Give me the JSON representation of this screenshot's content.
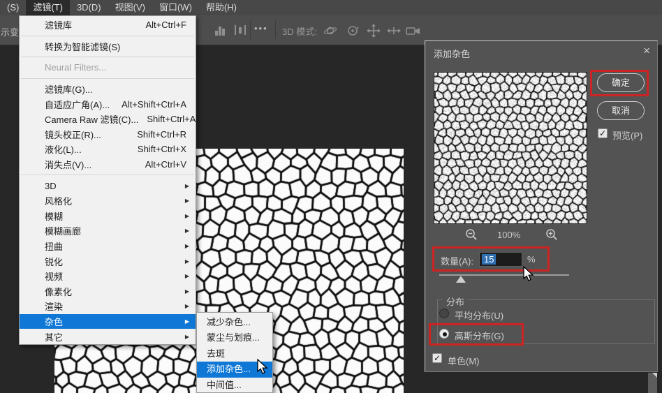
{
  "menubar": {
    "items": [
      {
        "label": "(S)",
        "active": false
      },
      {
        "label": "滤镜(T)",
        "active": true
      },
      {
        "label": "3D(D)",
        "active": false
      },
      {
        "label": "视图(V)",
        "active": false
      },
      {
        "label": "窗口(W)",
        "active": false
      },
      {
        "label": "帮助(H)",
        "active": false
      }
    ]
  },
  "options_bar": {
    "partial_left_text": "示变",
    "ellipsis": "•••",
    "mode_label": "3D 模式:"
  },
  "filter_menu": {
    "items": [
      {
        "label": "滤镜库",
        "shortcut": "Alt+Ctrl+F"
      },
      {
        "sep": true
      },
      {
        "label": "转换为智能滤镜(S)"
      },
      {
        "sep": true
      },
      {
        "label": "Neural Filters...",
        "disabled": true
      },
      {
        "sep": true
      },
      {
        "label": "滤镜库(G)..."
      },
      {
        "label": "自适应广角(A)...",
        "shortcut": "Alt+Shift+Ctrl+A"
      },
      {
        "label": "Camera Raw 滤镜(C)...",
        "shortcut": "Shift+Ctrl+A"
      },
      {
        "label": "镜头校正(R)...",
        "shortcut": "Shift+Ctrl+R"
      },
      {
        "label": "液化(L)...",
        "shortcut": "Shift+Ctrl+X"
      },
      {
        "label": "消失点(V)...",
        "shortcut": "Alt+Ctrl+V"
      },
      {
        "sep": true
      },
      {
        "label": "3D",
        "submenu": true
      },
      {
        "label": "风格化",
        "submenu": true
      },
      {
        "label": "模糊",
        "submenu": true
      },
      {
        "label": "模糊画廊",
        "submenu": true
      },
      {
        "label": "扭曲",
        "submenu": true
      },
      {
        "label": "锐化",
        "submenu": true
      },
      {
        "label": "视频",
        "submenu": true
      },
      {
        "label": "像素化",
        "submenu": true
      },
      {
        "label": "渲染",
        "submenu": true
      },
      {
        "label": "杂色",
        "submenu": true,
        "highlighted": true
      },
      {
        "label": "其它",
        "submenu": true
      }
    ]
  },
  "noise_submenu": {
    "items": [
      {
        "label": "减少杂色..."
      },
      {
        "label": "蒙尘与划痕..."
      },
      {
        "label": "去斑"
      },
      {
        "label": "添加杂色...",
        "highlighted": true
      },
      {
        "label": "中间值..."
      }
    ]
  },
  "dialog": {
    "title": "添加杂色",
    "close_glyph": "×",
    "ok_label": "确定",
    "cancel_label": "取消",
    "preview_label": "预览(P)",
    "preview_checked": true,
    "zoom_level": "100%",
    "amount_label": "数量(A):",
    "amount_value": "15",
    "percent_sign": "%",
    "distribution_label": "分布",
    "uniform_label": "平均分布(U)",
    "gaussian_label": "高斯分布(G)",
    "gaussian_selected": true,
    "monochromatic_label": "单色(M)",
    "monochromatic_checked": true,
    "check_glyph": "✓"
  },
  "colors": {
    "menu_highlight": "#0f78d7",
    "annotation_red": "#ce2323",
    "dialog_bg": "#535353",
    "workspace_bg": "#272727"
  }
}
